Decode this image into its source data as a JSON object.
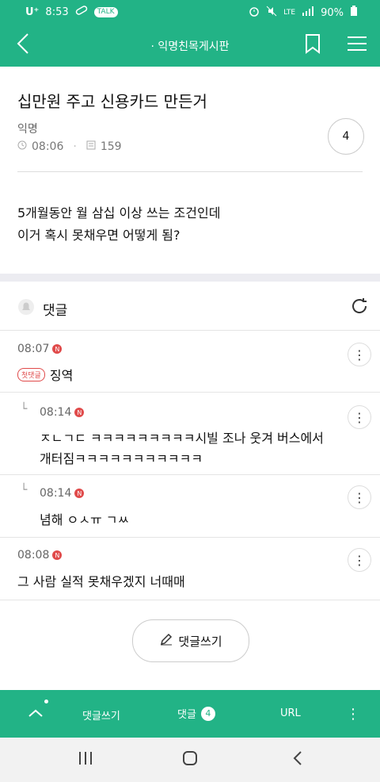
{
  "status_bar": {
    "carrier": "U⁺",
    "time": "8:53",
    "talk": "TALK",
    "lte": "LTE",
    "battery": "90%"
  },
  "header": {
    "title": "· 익명친목게시판"
  },
  "post": {
    "title": "십만원 주고 신용카드 만든거",
    "author": "익명",
    "time": "08:06",
    "views": "159",
    "comment_count": "4",
    "body_lines": [
      "5개월동안 월 삼십 이상 쓰는 조건인데",
      "이거 혹시 못채우면 어떻게 됨?"
    ]
  },
  "comments_header": {
    "label": "댓글"
  },
  "comments": [
    {
      "time": "08:07",
      "badge": "N",
      "tag": "첫댓글",
      "text": "징역"
    },
    {
      "time": "08:14",
      "badge": "N",
      "lines": [
        "ㅈㄴㄱㄷ ㅋㅋㅋㅋㅋㅋㅋㅋㅋ시빌 조나 웃겨 버스에서",
        "개터짐ㅋㅋㅋㅋㅋㅋㅋㅋㅋㅋㅋ"
      ]
    },
    {
      "time": "08:14",
      "badge": "N",
      "text": "념해 ㅇㅅㅠ ㄱㅆ"
    },
    {
      "time": "08:08",
      "badge": "N",
      "text": "그 사람 실적 못채우겠지 너때매"
    }
  ],
  "write_button": {
    "label": "댓글쓰기"
  },
  "bottom_bar": {
    "write": "댓글쓰기",
    "comments": "댓글",
    "comments_count": "4",
    "url": "URL"
  },
  "colors": {
    "accent": "#22b386",
    "badge": "#e04a4a"
  }
}
